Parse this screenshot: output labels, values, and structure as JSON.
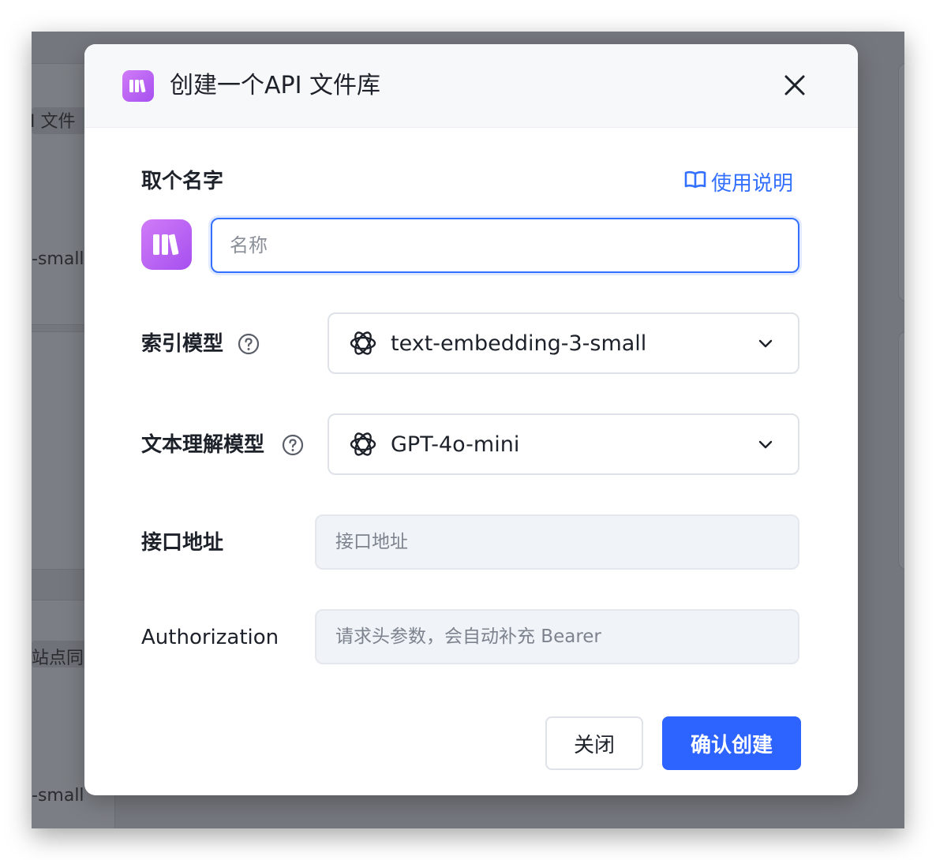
{
  "background": {
    "card_texts": [
      "I 文件",
      "-small",
      "站点同",
      "-small"
    ]
  },
  "modal": {
    "title": "创建一个API 文件库",
    "logo_icon": "library-books-icon",
    "close_icon": "close-icon"
  },
  "form": {
    "name_label": "取个名字",
    "guide_link": "使用说明",
    "guide_icon": "open-book-icon",
    "name_placeholder": "名称",
    "name_value": "",
    "index_model_label": "索引模型",
    "index_model_value": "text-embedding-3-small",
    "text_model_label": "文本理解模型",
    "text_model_value": "GPT-4o-mini",
    "model_icon": "openai-icon",
    "help_icon": "question-circle-icon",
    "dropdown_icon": "chevron-down-icon",
    "endpoint_label": "接口地址",
    "endpoint_placeholder": "接口地址",
    "auth_label": "Authorization",
    "auth_placeholder": "请求头参数，会自动补充 Bearer"
  },
  "buttons": {
    "close_label": "关闭",
    "confirm_label": "确认创建"
  },
  "colors": {
    "accent": "#3370ff",
    "confirm_button": "#2d63ff",
    "logo_gradient_start": "#d07cf7",
    "logo_gradient_end": "#a64ff0",
    "overlay": "#74777d"
  }
}
